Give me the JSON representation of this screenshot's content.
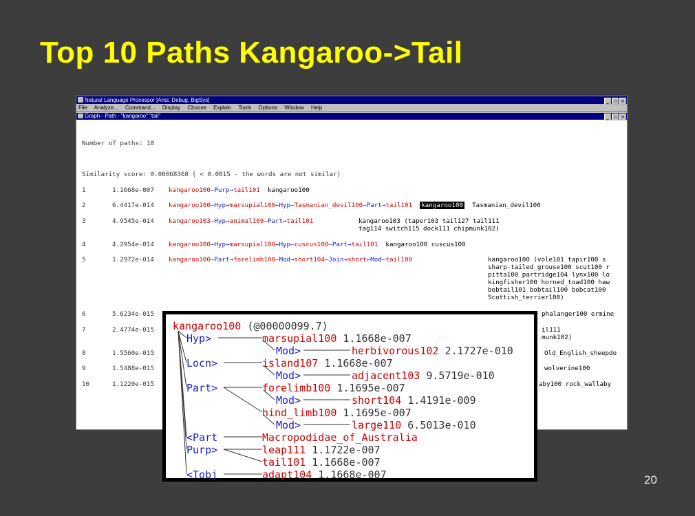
{
  "slide": {
    "title": "Top 10 Paths Kangaroo->Tail",
    "page_number": "20"
  },
  "window": {
    "title": "Natural Language Processor  [Ansi, Debug, BigSys]",
    "menu": [
      "File",
      "Analyze...",
      "Command...",
      "Display",
      "Choose",
      "Explain",
      "Tools",
      "Options",
      "Window",
      "Help"
    ],
    "child_title": "Graph - Path - \"kangaroo\" \"tail\""
  },
  "graph": {
    "num_paths": "Number of paths: 10",
    "similarity": "Similarity score: 0.00068368 ( < 0.0015 - the words are not similar)",
    "rows": [
      {
        "n": "1",
        "score": "1.1668e-007",
        "a": "kangaroo100",
        "b1": "—Purp→",
        "c": "tail101",
        "rest": "kangaroo100"
      },
      {
        "n": "2",
        "score": "6.4417e-014",
        "a": "kangaroo100",
        "b1": "—Hyp→",
        "c": "marsupial100",
        "b2": "←Hyp—",
        "d": "Tasmanian_devil100",
        "b3": "—Part→",
        "e": "tail101",
        "hl": "kangaroo100",
        "rest": "Tasmanian_devil100"
      },
      {
        "n": "3",
        "score": "4.9545e-014",
        "a": "kangaroo103",
        "b1": "—Hyp→",
        "c": "animal109",
        "b2": "—Part→",
        "d": "tail101",
        "rest": "kangaroo103  (taper103 tail127 tail111",
        "rest2": "tag114 switch115 dock111 chipmunk102)"
      },
      {
        "n": "4",
        "score": "4.2954e-014",
        "a": "kangaroo100",
        "b1": "—Hyp→",
        "c": "marsupial100",
        "b2": "←Hyp—",
        "d": "cuscus100",
        "b3": "—Part→",
        "e": "tail101",
        "rest": "kangaroo100  cuscus100"
      },
      {
        "n": "5",
        "score": "1.2972e-014",
        "a": "kangaroo100",
        "b1": "—Part→",
        "c": "forelimb100",
        "b2": "—Mod→",
        "d": "short104",
        "b3": "—Join→",
        "e": "short",
        "b4": "←Mod—",
        "f": "tail100",
        "rest": "kangaroo100  (vole101 tapir100 s",
        "rest2": "sharp-tailed_grouse100 scut100 r",
        "rest3": "pitta100 partridge104 lynx100 lo",
        "rest4": "kingfisher100 horned_toad100 haw",
        "rest5": "bobtail101 bobtail100 bobcat100 ",
        "rest6": "Scottish_terrier100)"
      },
      {
        "n": "6",
        "score": "5.6234e-015",
        "rest": "phalanger100 ermine"
      },
      {
        "n": "7",
        "score": "2.4774e-015",
        "rest": "il111",
        "rest2": "munk102)"
      },
      {
        "n": "8",
        "score": "1.5560e-015",
        "rest": "Old_English_sheepdo"
      },
      {
        "n": "9",
        "score": "1.5488e-015",
        "rest": "wolverine100"
      },
      {
        "n": "10",
        "score": "1.1220e-015",
        "rest": "aby100  rock_wallaby"
      }
    ]
  },
  "overlay": {
    "root": "kangaroo100",
    "root_score": "(@00000099.7)",
    "lines": [
      {
        "rel": "Hyp>",
        "word": "marsupial100",
        "score": "1.1668e-007"
      },
      {
        "rel": "Mod>",
        "word": "herbivorous102",
        "score": "2.1727e-010"
      },
      {
        "rel": "Locn>",
        "word": "island107",
        "score": "1.1668e-007"
      },
      {
        "rel": "Mod>",
        "word": "adjacent103",
        "score": "9.5719e-010"
      },
      {
        "rel": "Part>",
        "word": "forelimb100",
        "score": "1.1695e-007"
      },
      {
        "rel": "Mod>",
        "word": "short104",
        "score": "1.4191e-009"
      },
      {
        "rel": "",
        "word": "hind_limb100",
        "score": "1.1695e-007"
      },
      {
        "rel": "Mod>",
        "word": "large110",
        "score": "6.5013e-010"
      },
      {
        "rel": "<Part",
        "word": "Macropodidae_of_Australia",
        "score": ""
      },
      {
        "rel": "Purp>",
        "word": "leap111",
        "score": "1.1722e-007"
      },
      {
        "rel": "",
        "word": "tail101",
        "score": "1.1668e-007"
      },
      {
        "rel": "<Tobj",
        "word": "adapt104",
        "score": "1.1668e-007"
      }
    ]
  }
}
